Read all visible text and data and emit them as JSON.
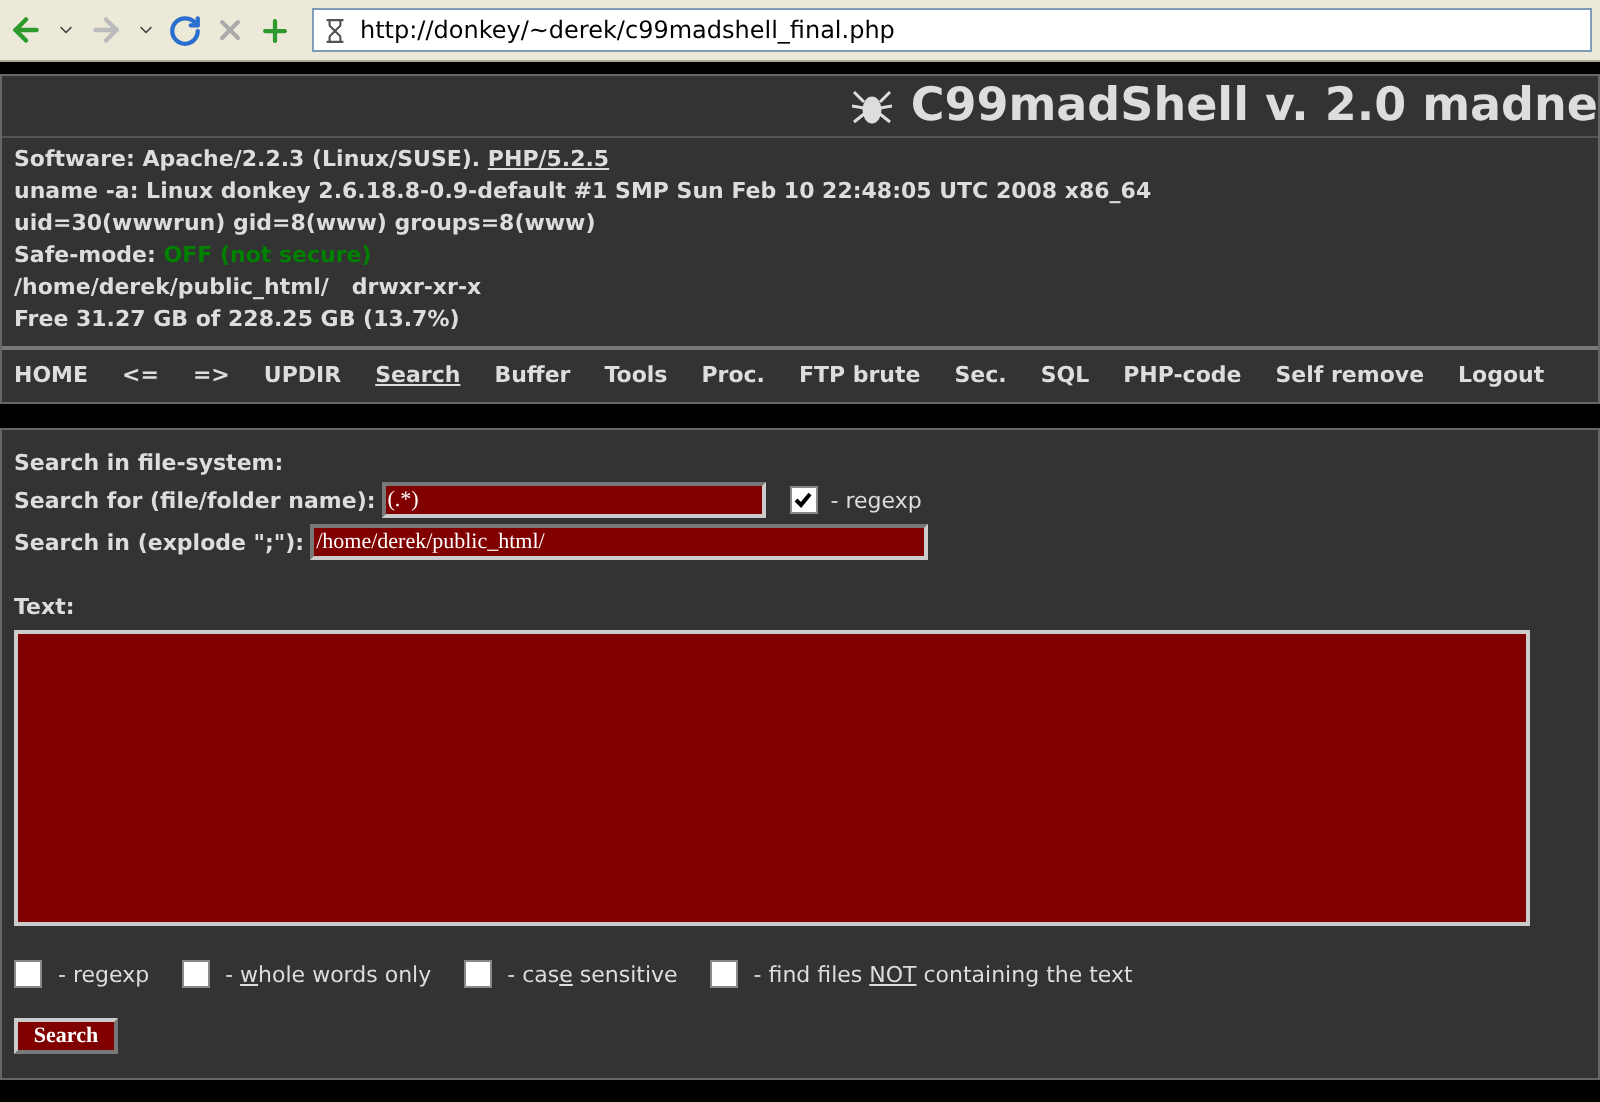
{
  "browser": {
    "url": "http://donkey/~derek/c99madshell_final.php"
  },
  "header": {
    "title": "C99madShell v. 2.0 madne"
  },
  "info": [
    {
      "kind": "software",
      "label": "Software: Apache/2.2.3 (Linux/SUSE). ",
      "link": "PHP/5.2.5"
    },
    {
      "kind": "plain",
      "text": "uname -a: Linux donkey 2.6.18.8-0.9-default #1 SMP Sun Feb 10 22:48:05 UTC 2008 x86_64"
    },
    {
      "kind": "plain",
      "text": "uid=30(wwwrun) gid=8(www) groups=8(www)"
    },
    {
      "kind": "safe",
      "label": "Safe-mode: ",
      "value": "OFF (not secure)",
      "secure": false
    },
    {
      "kind": "path",
      "path": "/home/derek/public_html/",
      "perms": "drwxr-xr-x"
    },
    {
      "kind": "plain",
      "text": "Free 31.27 GB of 228.25 GB (13.7%)"
    }
  ],
  "nav": [
    {
      "label": "HOME",
      "selected": false
    },
    {
      "label": "<=",
      "selected": false
    },
    {
      "label": "=>",
      "selected": false
    },
    {
      "label": "UPDIR",
      "selected": false
    },
    {
      "label": "Search",
      "selected": true
    },
    {
      "label": "Buffer",
      "selected": false
    },
    {
      "label": "Tools",
      "selected": false
    },
    {
      "label": "Proc.",
      "selected": false
    },
    {
      "label": "FTP brute",
      "selected": false
    },
    {
      "label": "Sec.",
      "selected": false
    },
    {
      "label": "SQL",
      "selected": false
    },
    {
      "label": "PHP-code",
      "selected": false
    },
    {
      "label": "Self remove",
      "selected": false
    },
    {
      "label": "Logout",
      "selected": false
    }
  ],
  "search": {
    "heading": "Search in file-system:",
    "name_label": "Search for (file/folder name):",
    "name_value": "(.*)",
    "name_regexp": {
      "checked": true,
      "label": "- regexp"
    },
    "dir_label": "Search in (explode \";\"):",
    "dir_value": "/home/derek/public_html/",
    "text_label": "Text:",
    "options": [
      {
        "checked": false,
        "parts": [
          {
            "text": "- regexp",
            "underline": false
          }
        ]
      },
      {
        "checked": false,
        "parts": [
          {
            "text": "- ",
            "underline": false
          },
          {
            "text": "w",
            "underline": true
          },
          {
            "text": "hole words only",
            "underline": false
          }
        ]
      },
      {
        "checked": false,
        "parts": [
          {
            "text": "- cas",
            "underline": false
          },
          {
            "text": "e",
            "underline": true
          },
          {
            "text": " sensitive",
            "underline": false
          }
        ]
      },
      {
        "checked": false,
        "parts": [
          {
            "text": "- find files ",
            "underline": false
          },
          {
            "text": "NOT",
            "underline": true
          },
          {
            "text": " containing the text",
            "underline": false
          }
        ]
      }
    ],
    "button": "Search"
  }
}
